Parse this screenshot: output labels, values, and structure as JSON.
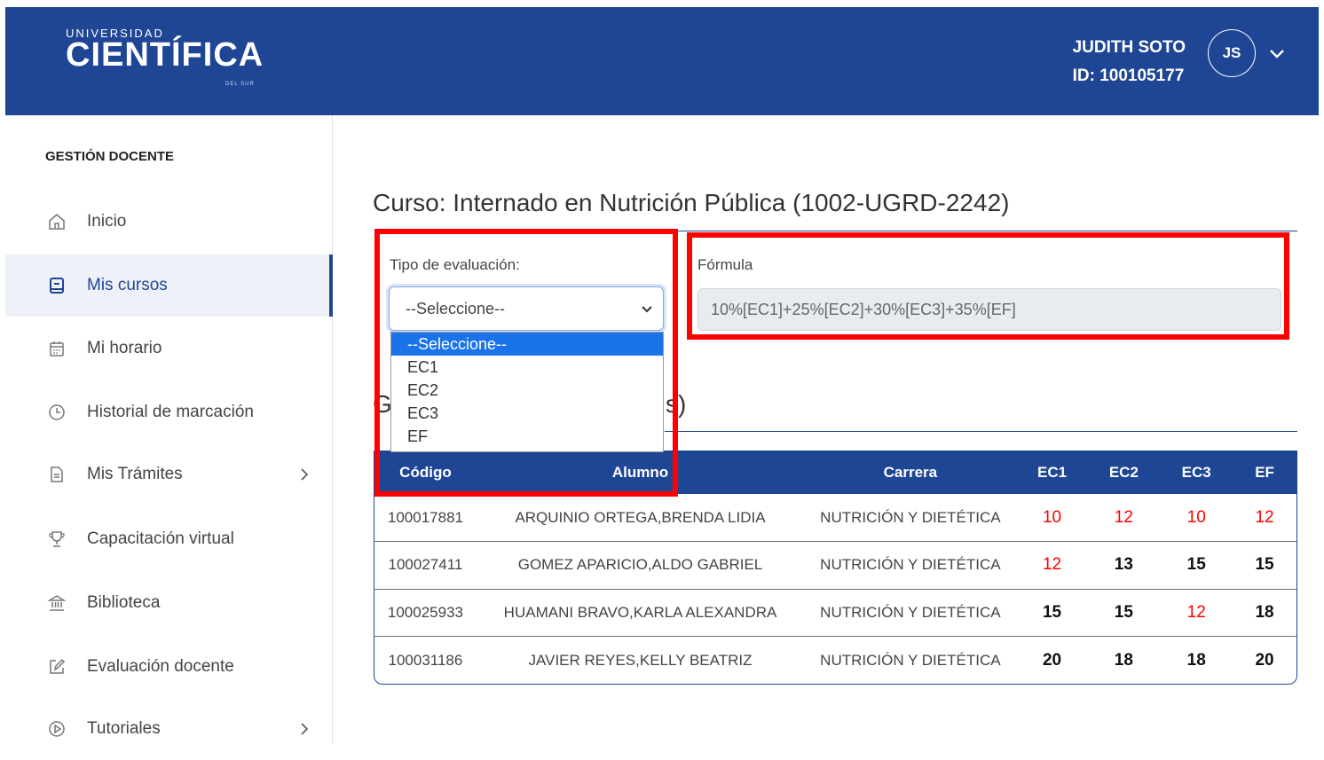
{
  "brand": {
    "line1": "UNIVERSIDAD",
    "line2": "CIENTÍFICA",
    "line3": "DEL SUR"
  },
  "user": {
    "name": "JUDITH SOTO",
    "id": "ID: 100105177",
    "initials": "JS"
  },
  "sidebar": {
    "heading": "GESTIÓN DOCENTE",
    "items": [
      {
        "label": "Inicio",
        "icon": "home-icon"
      },
      {
        "label": "Mis cursos",
        "icon": "book-icon",
        "active": true
      },
      {
        "label": "Mi horario",
        "icon": "calendar-icon"
      },
      {
        "label": "Historial de marcación",
        "icon": "clock-icon"
      },
      {
        "label": "Mis Trámites",
        "icon": "document-icon",
        "has_submenu": true
      },
      {
        "label": "Capacitación virtual",
        "icon": "trophy-icon"
      },
      {
        "label": "Biblioteca",
        "icon": "library-icon"
      },
      {
        "label": "Evaluación docente",
        "icon": "edit-icon"
      },
      {
        "label": "Tutoriales",
        "icon": "play-icon",
        "has_submenu": true
      }
    ]
  },
  "main": {
    "course_title": "Curso: Internado en Nutrición Pública (1002-UGRD-2242)",
    "eval_type": {
      "label": "Tipo de evaluación:",
      "selected": "--Seleccione--",
      "options": [
        "--Seleccione--",
        "EC1",
        "EC2",
        "EC3",
        "EF"
      ]
    },
    "formula": {
      "label": "Fórmula",
      "value": "10%[EC1]+25%[EC2]+30%[EC3]+35%[EF]"
    },
    "section_title_left": "G",
    "section_title_right": "s)"
  },
  "table": {
    "headers": [
      "Código",
      "Alumno",
      "Carrera",
      "EC1",
      "EC2",
      "EC3",
      "EF"
    ],
    "rows": [
      {
        "codigo": "100017881",
        "alumno": "ARQUINIO ORTEGA,BRENDA LIDIA",
        "carrera": "NUTRICIÓN Y DIETÉTICA",
        "ec1": "10",
        "ec2": "12",
        "ec3": "10",
        "ef": "12"
      },
      {
        "codigo": "100027411",
        "alumno": "GOMEZ APARICIO,ALDO GABRIEL",
        "carrera": "NUTRICIÓN Y DIETÉTICA",
        "ec1": "12",
        "ec2": "13",
        "ec3": "15",
        "ef": "15"
      },
      {
        "codigo": "100025933",
        "alumno": "HUAMANI BRAVO,KARLA ALEXANDRA",
        "carrera": "NUTRICIÓN Y DIETÉTICA",
        "ec1": "15",
        "ec2": "15",
        "ec3": "12",
        "ef": "18"
      },
      {
        "codigo": "100031186",
        "alumno": "JAVIER REYES,KELLY BEATRIZ",
        "carrera": "NUTRICIÓN Y DIETÉTICA",
        "ec1": "20",
        "ec2": "18",
        "ec3": "18",
        "ef": "20"
      }
    ]
  },
  "colors": {
    "brand_blue": "#1f4694",
    "low_grade": "#ff0000",
    "highlight": "#ff0000"
  }
}
